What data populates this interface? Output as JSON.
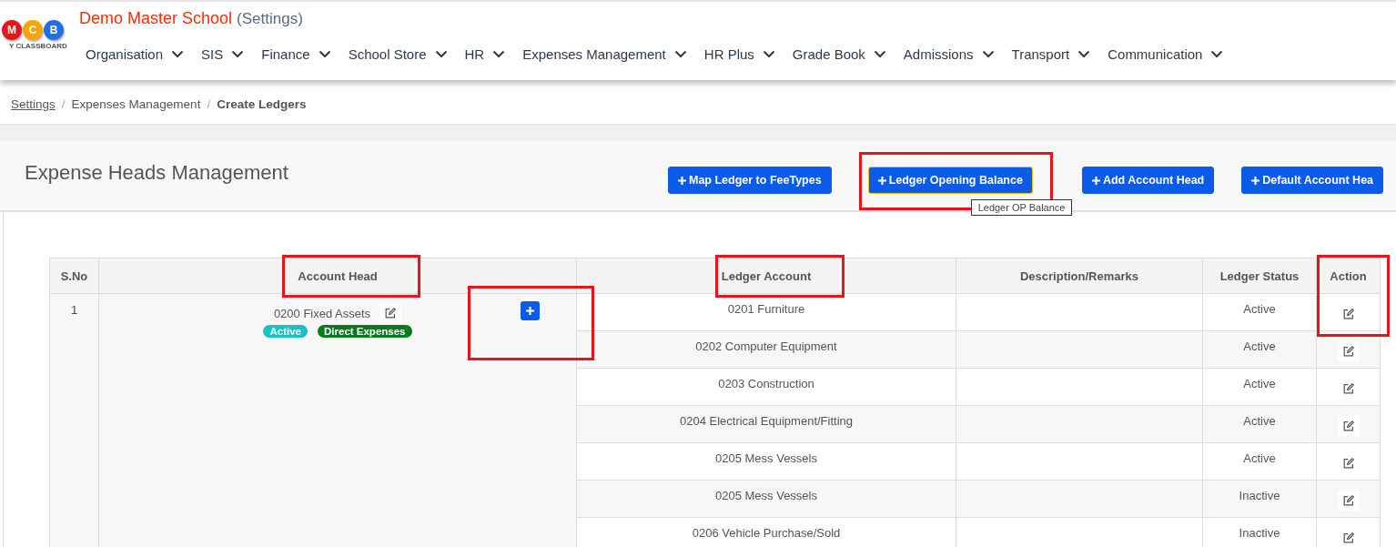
{
  "logo": {
    "letters": [
      {
        "text": "M",
        "color": "#e8141c"
      },
      {
        "text": "C",
        "color": "#f7a400"
      },
      {
        "text": "B",
        "color": "#1e6ee8"
      }
    ],
    "caption": "Y CLASSBOARD"
  },
  "header": {
    "school": "Demo Master School",
    "context": "(Settings)"
  },
  "nav": [
    "Organisation",
    "SIS",
    "Finance",
    "School Store",
    "HR",
    "Expenses Management",
    "HR Plus",
    "Grade Book",
    "Admissions",
    "Transport",
    "Communication"
  ],
  "breadcrumb": [
    {
      "label": "Settings",
      "link": true
    },
    {
      "separator": "/",
      "label": "Expenses Management",
      "link": false
    },
    {
      "separator": "/",
      "label": "Create Ledgers",
      "link": false
    }
  ],
  "panel": {
    "title": "Expense Heads Management"
  },
  "buttons": [
    {
      "label": "Map Ledger to FeeTypes",
      "focused": false,
      "highlighted": false
    },
    {
      "label": "Ledger Opening Balance",
      "focused": true,
      "highlighted": true
    },
    {
      "label": "Add Account Head",
      "focused": false,
      "highlighted": false
    },
    {
      "label": "Default Account Hea",
      "focused": false,
      "highlighted": false
    }
  ],
  "tooltip": "Ledger OP Balance",
  "table": {
    "columns": [
      {
        "label": "S.No",
        "highlighted": false
      },
      {
        "label": "Account Head",
        "highlighted": true
      },
      {
        "label": "Ledger Account",
        "highlighted": true
      },
      {
        "label": "Description/Remarks",
        "highlighted": false
      },
      {
        "label": "Ledger Status",
        "highlighted": false
      },
      {
        "label": "Action",
        "highlighted": true
      }
    ],
    "group": {
      "sno": "1",
      "account_head": "0200 Fixed Assets",
      "add_highlighted": true,
      "badges": [
        {
          "label": "Active",
          "color": "#17c1c9"
        },
        {
          "label": "Direct Expenses",
          "color": "#0b7a1d"
        }
      ]
    },
    "rows": [
      {
        "ledger": "0201 Furniture",
        "status": "Active"
      },
      {
        "ledger": "0202 Computer Equipment",
        "status": "Active"
      },
      {
        "ledger": "0203 Construction",
        "status": "Active"
      },
      {
        "ledger": "0204 Electrical Equipment/Fitting",
        "status": "Active"
      },
      {
        "ledger": "0205 Mess Vessels",
        "status": "Active"
      },
      {
        "ledger": "0205 Mess Vessels",
        "status": "Inactive"
      },
      {
        "ledger": "0206 Vehicle Purchase/Sold",
        "status": "Inactive"
      }
    ]
  }
}
